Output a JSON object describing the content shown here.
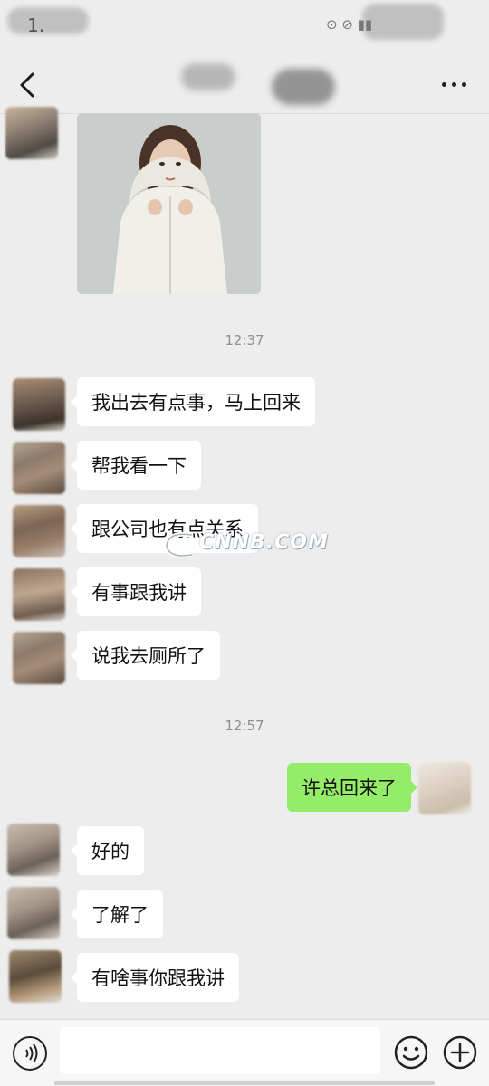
{
  "status_bar": {
    "time": "1.",
    "network": "⊙ ⊘ ▮▮"
  },
  "nav": {
    "back_icon": "chevron-left-icon",
    "title": "",
    "more_icon": "more-dots-icon"
  },
  "chat": {
    "timestamps": [
      "12:37",
      "12:57"
    ],
    "messages_1237": [
      "我出去有点事，马上回来",
      "帮我看一下",
      "跟公司也有点关系",
      "有事跟我讲",
      "说我去厕所了"
    ],
    "self_message": "许总回来了",
    "messages_1257": [
      "好的",
      "了解了",
      "有啥事你跟我讲"
    ]
  },
  "watermark": {
    "text": "CNNB.COM"
  },
  "input_bar": {
    "placeholder": "",
    "voice_icon": "voice-icon",
    "emoji_icon": "emoji-icon",
    "plus_icon": "plus-icon"
  },
  "colors": {
    "background": "#ededed",
    "bubble": "#ffffff",
    "self_bubble": "#95ec69",
    "timestamp": "#8f8f8f"
  }
}
